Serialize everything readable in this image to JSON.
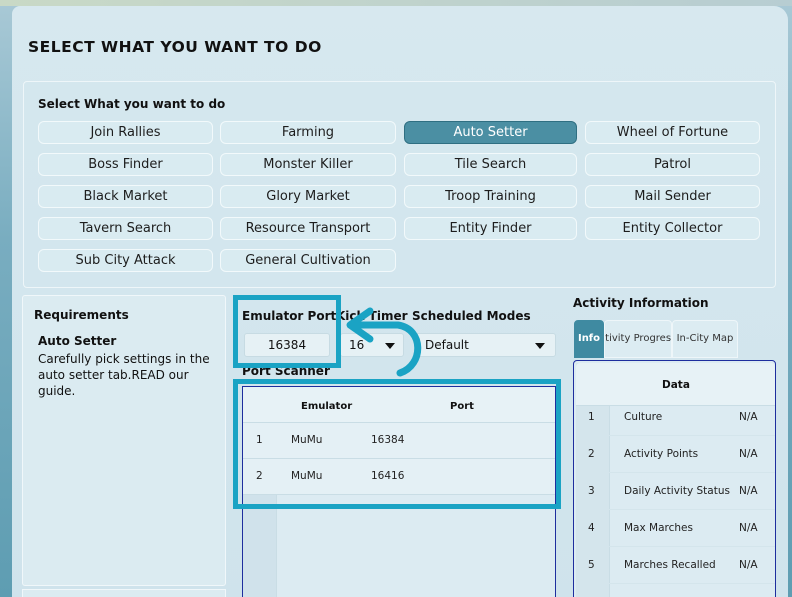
{
  "title": "SELECT WHAT YOU WANT TO DO",
  "selection": {
    "label": "Select What you want to do",
    "buttons": [
      "Join Rallies",
      "Farming",
      "Auto Setter",
      "Wheel of Fortune",
      "Boss Finder",
      "Monster Killer",
      "Tile Search",
      "Patrol",
      "Black Market",
      "Glory Market",
      "Troop Training",
      "Mail Sender",
      "Tavern Search",
      "Resource Transport",
      "Entity Finder",
      "Entity Collector",
      "Sub City Attack",
      "General Cultivation"
    ],
    "active": "Auto Setter",
    "active_color": "#4b8fa3"
  },
  "requirements": {
    "title": "Requirements",
    "name": "Auto Setter",
    "description": "Carefully pick settings in the auto setter tab.READ our guide."
  },
  "settings": {
    "emulator_port_label": "Emulator Port",
    "emulator_port_value": "16384",
    "kick_timer_label": "Kick Timer",
    "kick_timer_value": "16",
    "scheduled_modes_label": "Scheduled Modes",
    "scheduled_modes_value": "Default"
  },
  "port_scanner": {
    "label": "Port Scanner",
    "columns": [
      "Emulator",
      "Port"
    ],
    "rows": [
      {
        "index": "1",
        "emulator": "MuMu",
        "port": "16384"
      },
      {
        "index": "2",
        "emulator": "MuMu",
        "port": "16416"
      }
    ]
  },
  "activity": {
    "title": "Activity Information",
    "tabs": [
      "Info",
      "Activity Progress",
      "In-City Map"
    ],
    "column": "Data",
    "rows": [
      {
        "index": "1",
        "name": "Culture",
        "value": "N/A"
      },
      {
        "index": "2",
        "name": "Activity Points",
        "value": "N/A"
      },
      {
        "index": "3",
        "name": "Daily Activity Status",
        "value": "N/A"
      },
      {
        "index": "4",
        "name": "Max Marches",
        "value": "N/A"
      },
      {
        "index": "5",
        "name": "Marches Recalled",
        "value": "N/A"
      }
    ]
  },
  "annotation": {
    "highlight_color": "#1aa3c4",
    "arrow_icon": "curved-arrow-left-icon"
  }
}
